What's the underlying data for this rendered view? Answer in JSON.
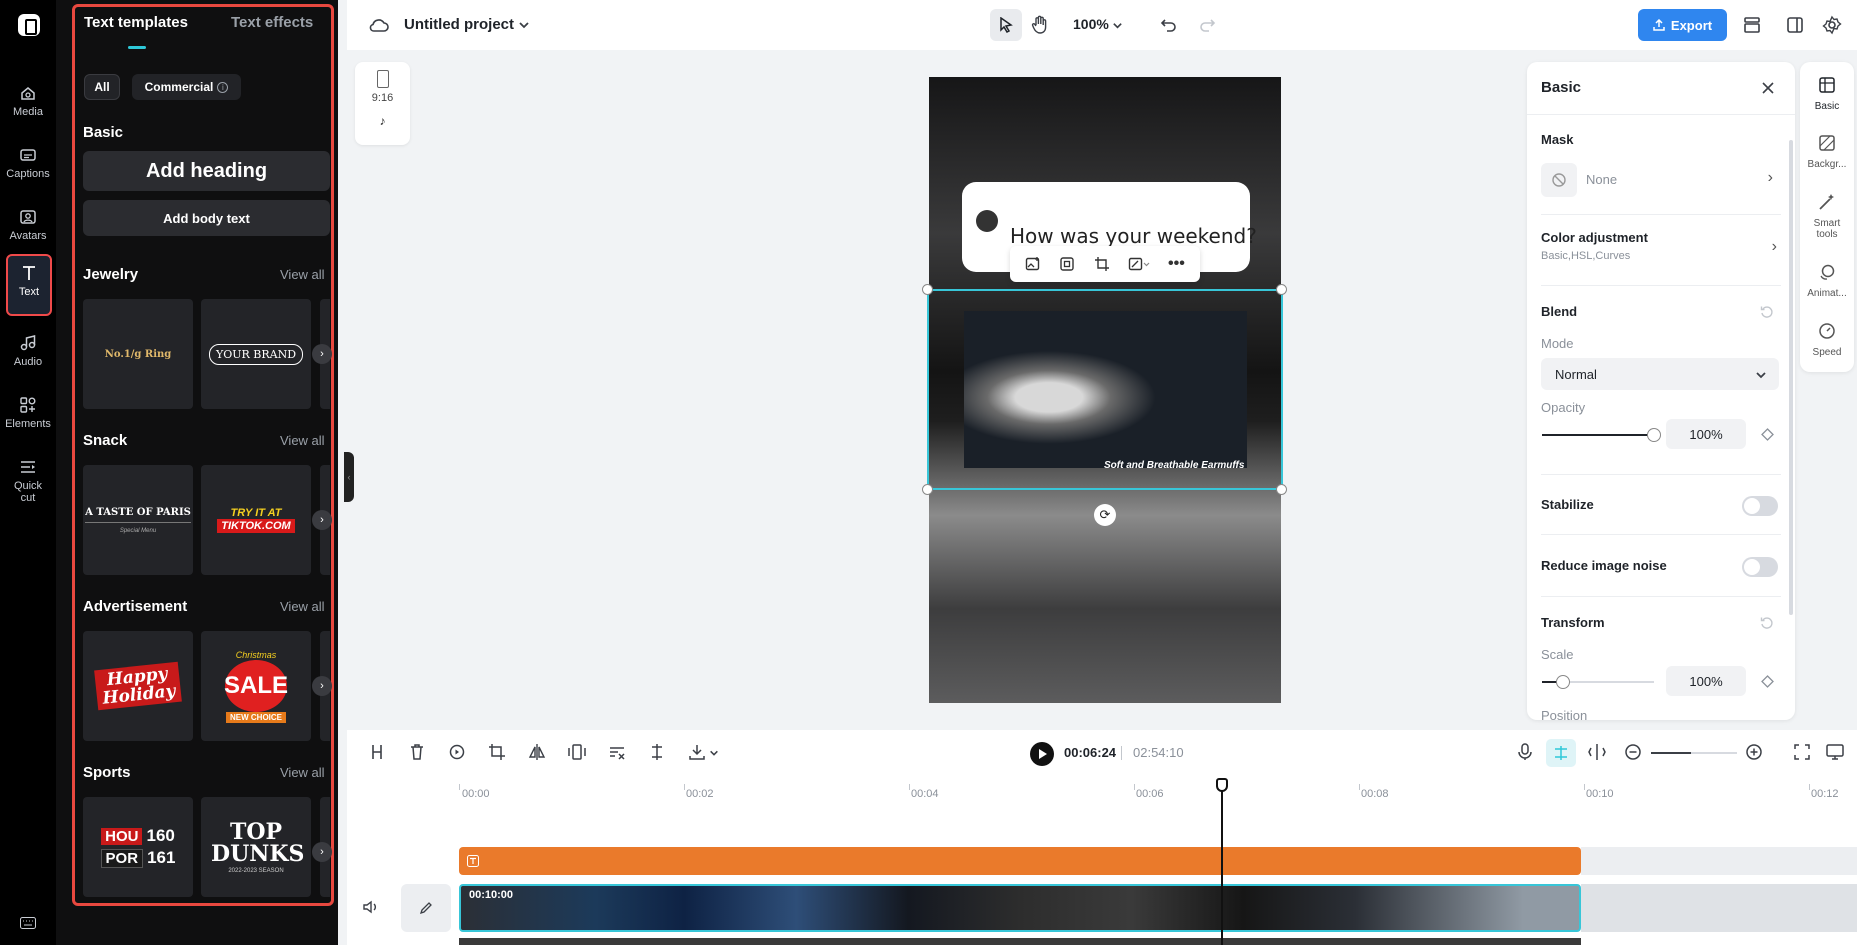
{
  "app": {
    "project_title": "Untitled project",
    "zoom": "100%",
    "export_label": "Export",
    "accent_color": "#2f86ef",
    "highlight_color": "#e8483f"
  },
  "rail": {
    "items": [
      {
        "label": "Media",
        "icon": "media-icon"
      },
      {
        "label": "Captions",
        "icon": "captions-icon"
      },
      {
        "label": "Avatars",
        "icon": "avatars-icon"
      },
      {
        "label": "Text",
        "icon": "text-icon",
        "active": true
      },
      {
        "label": "Audio",
        "icon": "audio-icon"
      },
      {
        "label": "Elements",
        "icon": "elements-icon"
      },
      {
        "label": "Quick",
        "label2": "cut",
        "icon": "quick-cut-icon"
      }
    ]
  },
  "panel": {
    "tabs": [
      "Text templates",
      "Text effects"
    ],
    "filters": [
      "All",
      "Commercial"
    ],
    "basic_title": "Basic",
    "add_heading": "Add heading",
    "add_body": "Add body text",
    "view_all": "View all",
    "sections": [
      {
        "title": "Jewelry",
        "thumbs": [
          "No.1/g Ring",
          "YOUR BRAND"
        ]
      },
      {
        "title": "Snack",
        "thumbs": [
          "A TASTE OF PARIS",
          "TRY IT AT",
          "TIKTOK.COM"
        ]
      },
      {
        "title": "Advertisement",
        "thumbs": [
          "Happy Holiday",
          "SALE"
        ]
      },
      {
        "title": "Sports",
        "thumbs": [
          "HOU",
          "POR",
          "160",
          "161",
          "TOP DUNKS",
          "2022-2023 SEASON"
        ]
      }
    ],
    "thumb_extra": {
      "paris_sub": "Special Menu",
      "christmas": "Christmas",
      "new_choice": "NEW CHOICE"
    }
  },
  "canvas": {
    "ratio": "9:16",
    "bubble_text": "How was your weekend?",
    "photo_caption": "Soft and Breathable Earmuffs"
  },
  "props": {
    "title": "Basic",
    "mask": {
      "label": "Mask",
      "value": "None"
    },
    "color_adjustment": {
      "label": "Color adjustment",
      "sub": "Basic,HSL,Curves"
    },
    "blend": {
      "label": "Blend",
      "mode_label": "Mode",
      "mode_value": "Normal",
      "opacity_label": "Opacity",
      "opacity_value": "100%",
      "opacity_fraction": 1.0
    },
    "stabilize": {
      "label": "Stabilize",
      "on": false
    },
    "reduce_noise": {
      "label": "Reduce image noise",
      "on": false
    },
    "transform": {
      "label": "Transform",
      "scale_label": "Scale",
      "scale_value": "100%",
      "position_label": "Position"
    }
  },
  "sidetabs": [
    {
      "label": "Basic",
      "icon": "basic-icon"
    },
    {
      "label": "Backgr...",
      "icon": "background-icon"
    },
    {
      "label": "Smart",
      "label2": "tools",
      "icon": "smart-tools-icon"
    },
    {
      "label": "Animat...",
      "icon": "animation-icon"
    },
    {
      "label": "Speed",
      "icon": "speed-icon"
    }
  ],
  "timeline": {
    "current_time": "00:06:24",
    "total_time": "02:54:10",
    "ruler": [
      "00:00",
      "00:02",
      "00:04",
      "00:06",
      "00:08",
      "00:10",
      "00:12"
    ],
    "clip_duration": "00:10:00"
  }
}
